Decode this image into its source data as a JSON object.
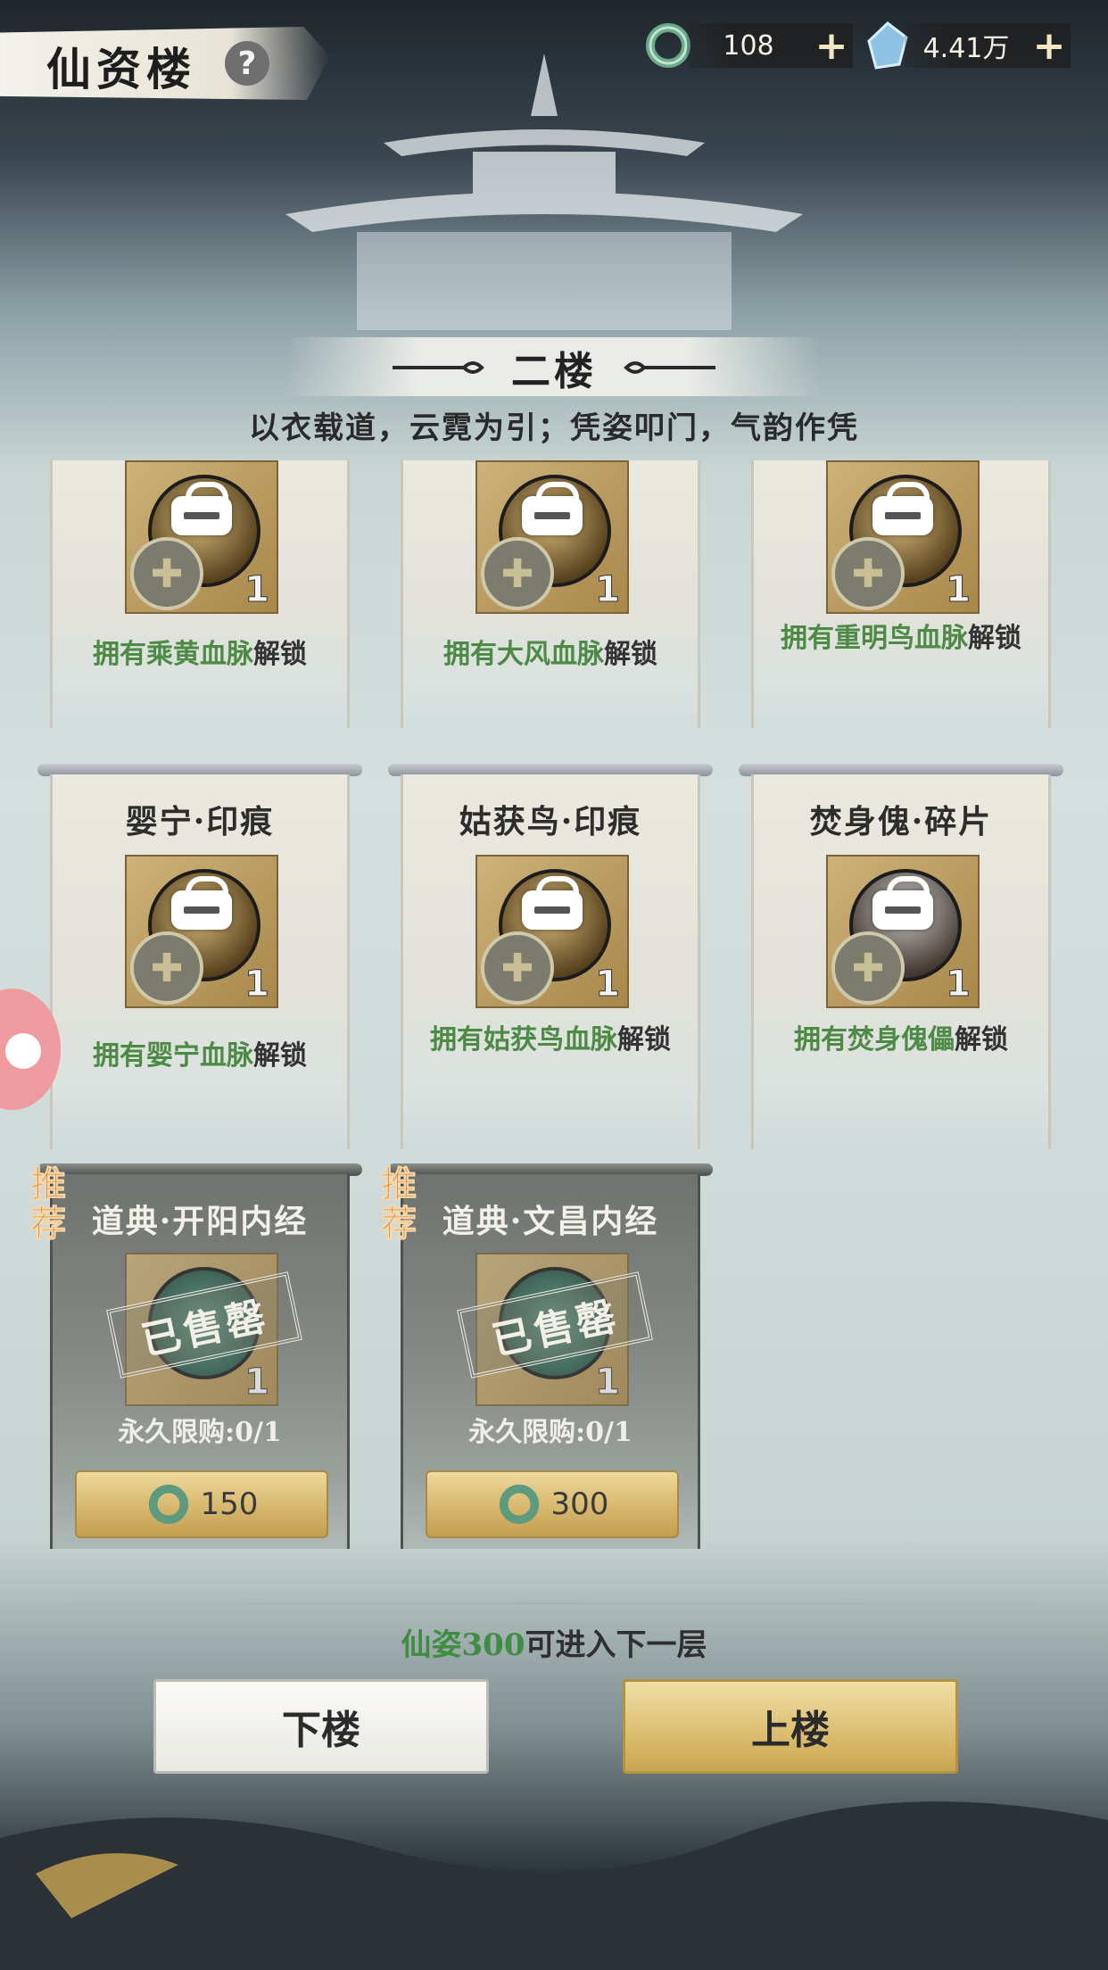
{
  "header": {
    "title": "仙资楼",
    "help_icon": "?",
    "jade": {
      "value": "108",
      "plus": "+"
    },
    "crystal": {
      "value": "4.41万",
      "plus": "+"
    }
  },
  "floor": {
    "name": "二楼",
    "motto": "以衣载道，云霓为引；凭姿叩门，气韵作凭"
  },
  "row1": [
    {
      "count": "1",
      "req_green": "拥有乘黄血脉",
      "req_rest": "解锁"
    },
    {
      "count": "1",
      "req_green": "拥有大风血脉",
      "req_rest": "解锁"
    },
    {
      "count": "1",
      "req_green": "拥有重明鸟血脉",
      "req_rest": "解锁"
    }
  ],
  "row2": [
    {
      "name": "婴宁·印痕",
      "count": "1",
      "req_green": "拥有婴宁血脉",
      "req_rest": "解锁"
    },
    {
      "name": "姑获鸟·印痕",
      "count": "1",
      "req_green": "拥有姑获鸟血脉",
      "req_rest": "解锁"
    },
    {
      "name": "焚身傀·碎片",
      "count": "1",
      "req_green": "拥有焚身傀儡",
      "req_rest": "解锁"
    }
  ],
  "row3": [
    {
      "tag": "推荐",
      "name": "道典·开阳内经",
      "count": "1",
      "stamp": "已售罄",
      "limit": "永久限购:0/1",
      "price": "150"
    },
    {
      "tag": "推荐",
      "name": "道典·文昌内经",
      "count": "1",
      "stamp": "已售罄",
      "limit": "永久限购:0/1",
      "price": "300"
    }
  ],
  "footer": {
    "next_green": "仙姿300",
    "next_rest": "可进入下一层",
    "down_label": "下楼",
    "up_label": "上楼"
  },
  "colors": {
    "green": "#4c8a46",
    "gold": "#d4b56a"
  }
}
